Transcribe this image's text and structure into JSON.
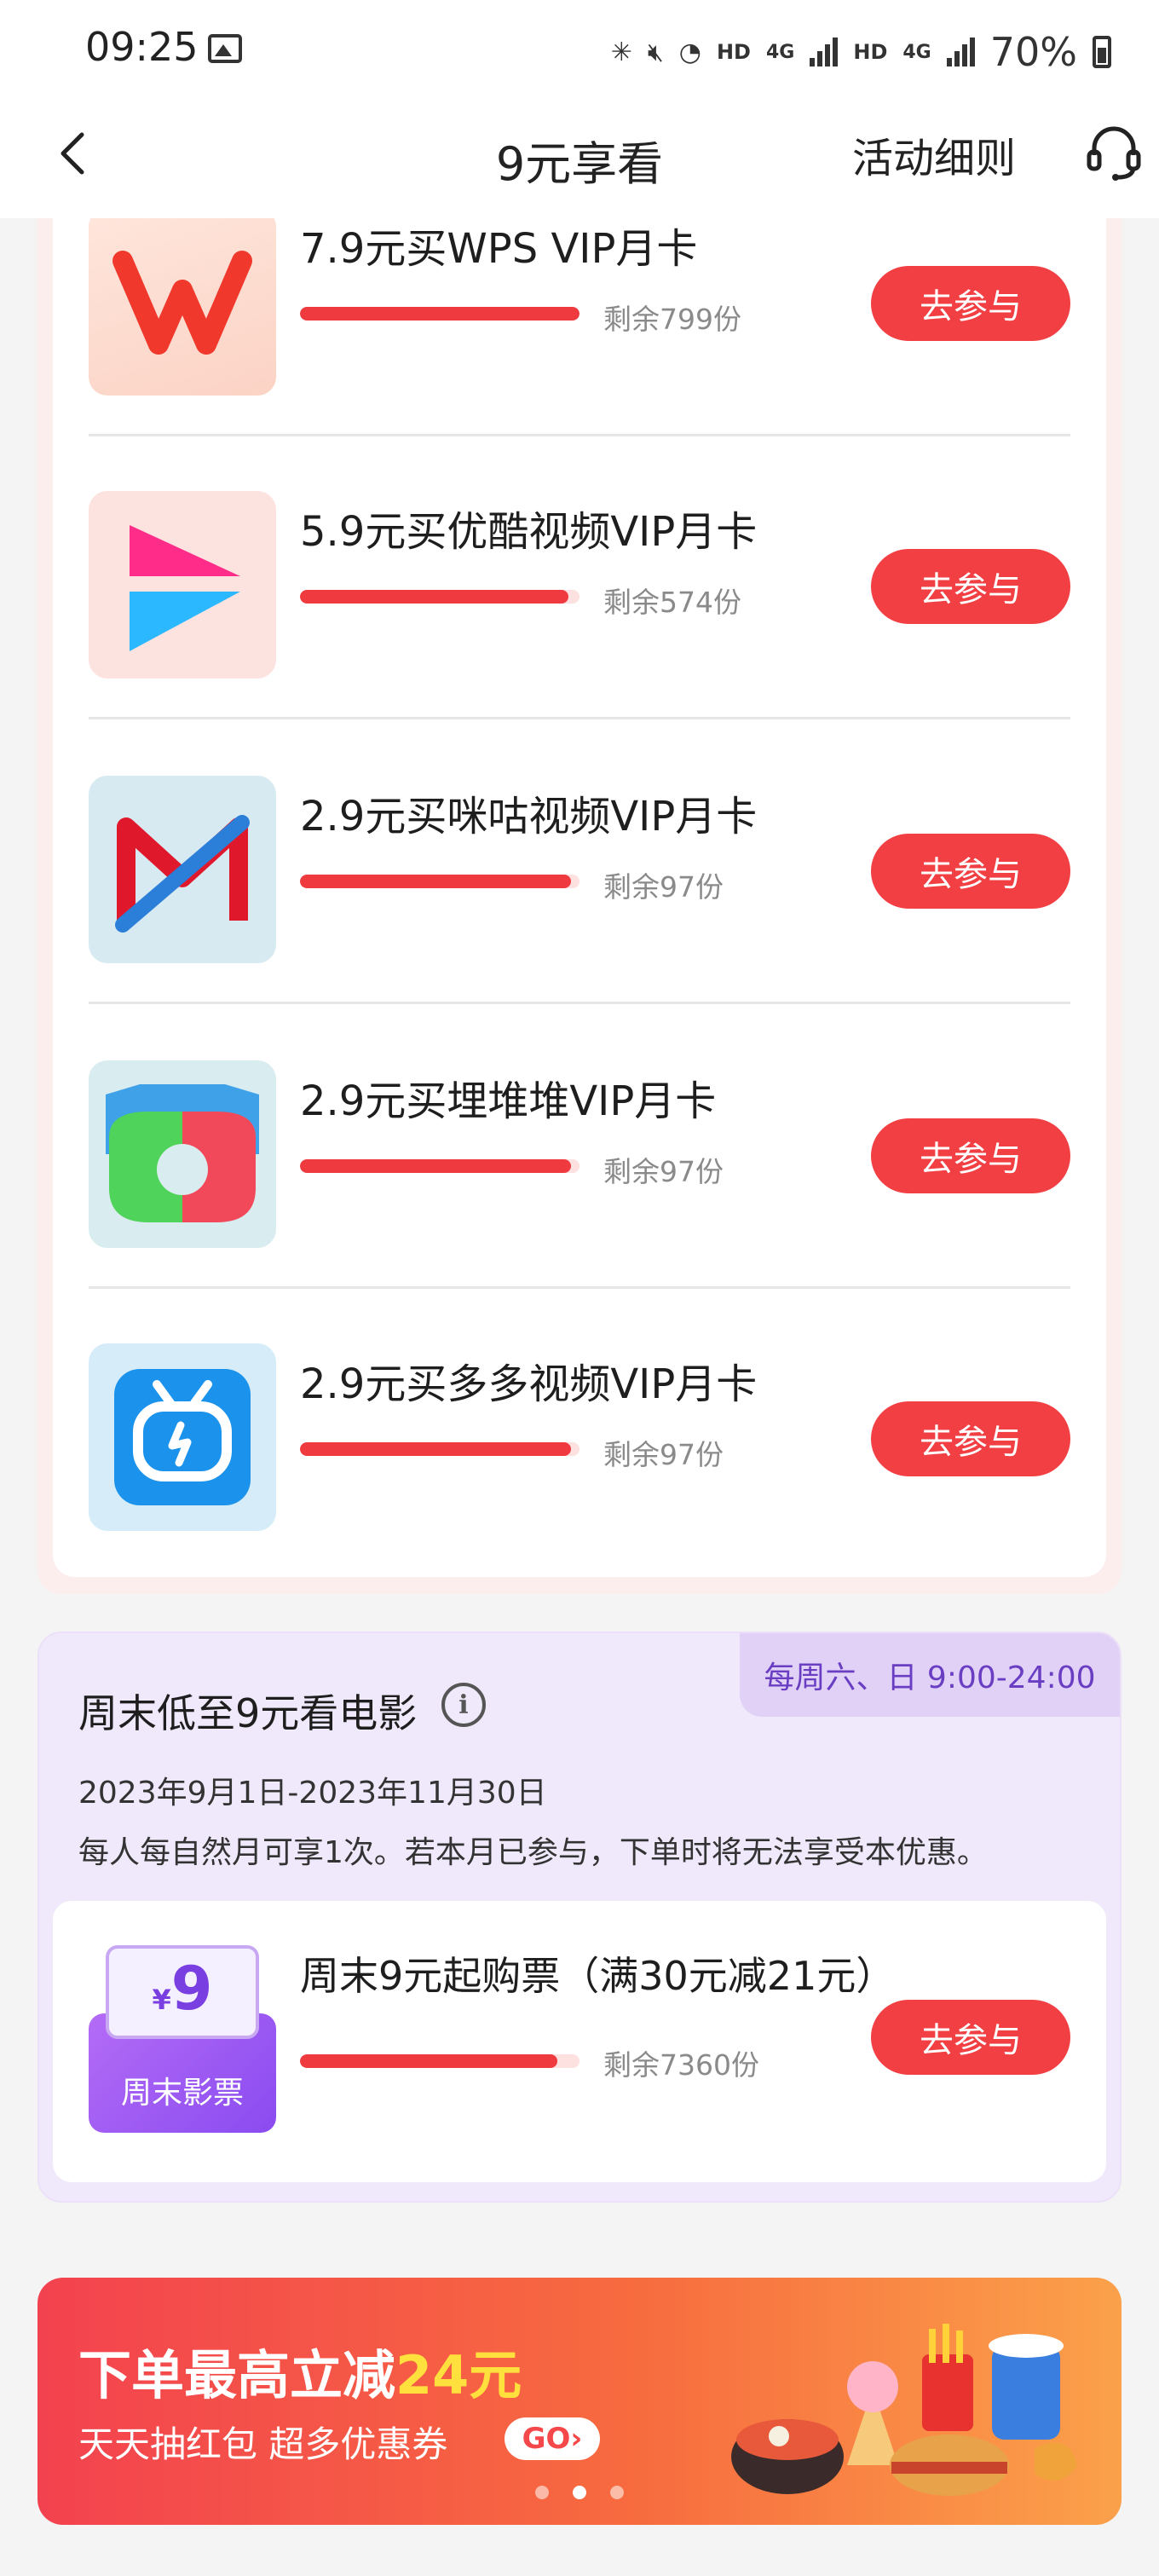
{
  "status_bar": {
    "time": "09:25",
    "hd1": "HD",
    "net1": "4G",
    "hd2": "HD",
    "net2": "4G",
    "battery": "70%"
  },
  "nav": {
    "title": "9元享看",
    "rules_label": "活动细则"
  },
  "items": [
    {
      "title": "7.9元买WPS VIP月卡",
      "remaining": "剩余799份",
      "progress": 1.0,
      "button": "去参与",
      "logo": "wps-logo-icon"
    },
    {
      "title": "5.9元买优酷视频VIP月卡",
      "remaining": "剩余574份",
      "progress": 0.96,
      "button": "去参与",
      "logo": "youku-logo-icon"
    },
    {
      "title": "2.9元买咪咕视频VIP月卡",
      "remaining": "剩余97份",
      "progress": 0.97,
      "button": "去参与",
      "logo": "migu-logo-icon"
    },
    {
      "title": "2.9元买埋堆堆VIP月卡",
      "remaining": "剩余97份",
      "progress": 0.97,
      "button": "去参与",
      "logo": "maiduidui-logo-icon"
    },
    {
      "title": "2.9元买多多视频VIP月卡",
      "remaining": "剩余97份",
      "progress": 0.97,
      "button": "去参与",
      "logo": "duoduo-video-logo-icon"
    }
  ],
  "movie": {
    "tag": "每周六、日 9:00-24:00",
    "title": "周末低至9元看电影",
    "date_range": "2023年9月1日-2023年11月30日",
    "rule": "每人每自然月可享1次。若本月已参与，下单时将无法享受本优惠。",
    "ticket": {
      "yen": "¥",
      "price": "9",
      "label": "周末影票"
    },
    "offer": {
      "title": "周末9元起购票（满30元减21元）",
      "remaining": "剩余7360份",
      "progress": 0.92,
      "button": "去参与"
    }
  },
  "banner": {
    "headline_prefix": "下单最高立减",
    "headline_highlight": "24元",
    "sub": "天天抽红包 超多优惠券",
    "go": "GO",
    "dots_total": 3,
    "dots_active": 2
  },
  "colors": {
    "accent_red": "#f23f43",
    "progress_red": "#ef3b3f",
    "movie_purple": "#6a3ec2"
  }
}
